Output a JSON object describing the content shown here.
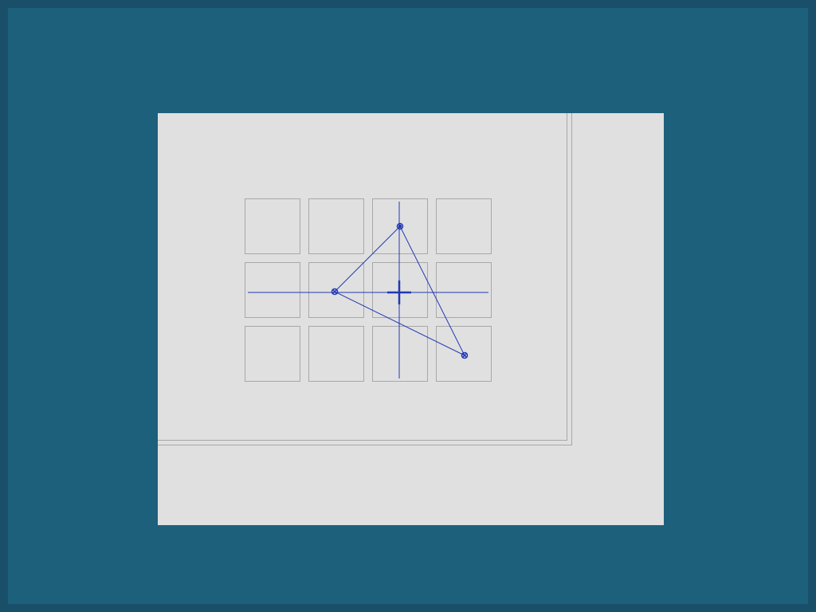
{
  "colors": {
    "desktop_background": "#1d607c",
    "desktop_border": "#1a4f6a",
    "panel_background": "#e0e0e0",
    "grid_line": "#a8a8a8",
    "calibration_stroke": "#2238b4"
  },
  "calibration": {
    "grid": {
      "rows": 3,
      "columns": 4
    },
    "touch_points": [
      {
        "row": 0,
        "col": 2,
        "offset": "center"
      },
      {
        "row": 1,
        "col": 1,
        "offset": "center-right"
      },
      {
        "row": 2,
        "col": 3,
        "offset": "center"
      }
    ],
    "crosshair_cell": {
      "row": 1,
      "col": 2
    }
  },
  "icons": {
    "target_marker": "target-crosshair-icon",
    "touch_marker": "touch-point-icon"
  }
}
